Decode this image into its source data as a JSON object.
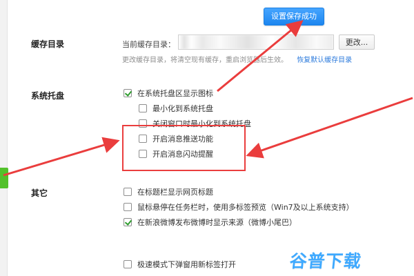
{
  "toast": {
    "text": "设置保存成功"
  },
  "sections": {
    "cache": {
      "title": "缓存目录",
      "current_label": "当前缓存目录：",
      "input_value": "",
      "change_button": "更改...",
      "hint": "更改缓存目录，将清空现有缓存，重启浏览器后生效。",
      "restore_link": "恢复默认缓存目录"
    },
    "tray": {
      "title": "系统托盘",
      "items": [
        {
          "label": "在系统托盘区显示图标",
          "checked": true
        },
        {
          "label": "最小化到系统托盘",
          "checked": false
        },
        {
          "label": "关闭窗口时最小化到系统托盘",
          "checked": false
        },
        {
          "label": "开启消息推送功能",
          "checked": false
        },
        {
          "label": "开启消息闪动提醒",
          "checked": false
        }
      ]
    },
    "other": {
      "title": "其它",
      "items": [
        {
          "label": "在标题栏显示网页标题",
          "checked": false
        },
        {
          "label": "鼠标悬停在任务栏时，使用多标签预览（Win7及以上系统支持）",
          "checked": false
        },
        {
          "label": "在新浪微博发布微博时显示来源（微博小尾巴）",
          "checked": true
        },
        {
          "label": "极速模式下弹窗用新标签打开",
          "checked": false
        }
      ]
    }
  },
  "watermark": {
    "text": "谷普下载"
  },
  "colors": {
    "accent": "#1d86ef",
    "annotation_red": "#ea3d3d",
    "check_green": "#2d9b2d",
    "left_tab_green": "#52c12b",
    "watermark_blue": "#3ea9ff"
  }
}
